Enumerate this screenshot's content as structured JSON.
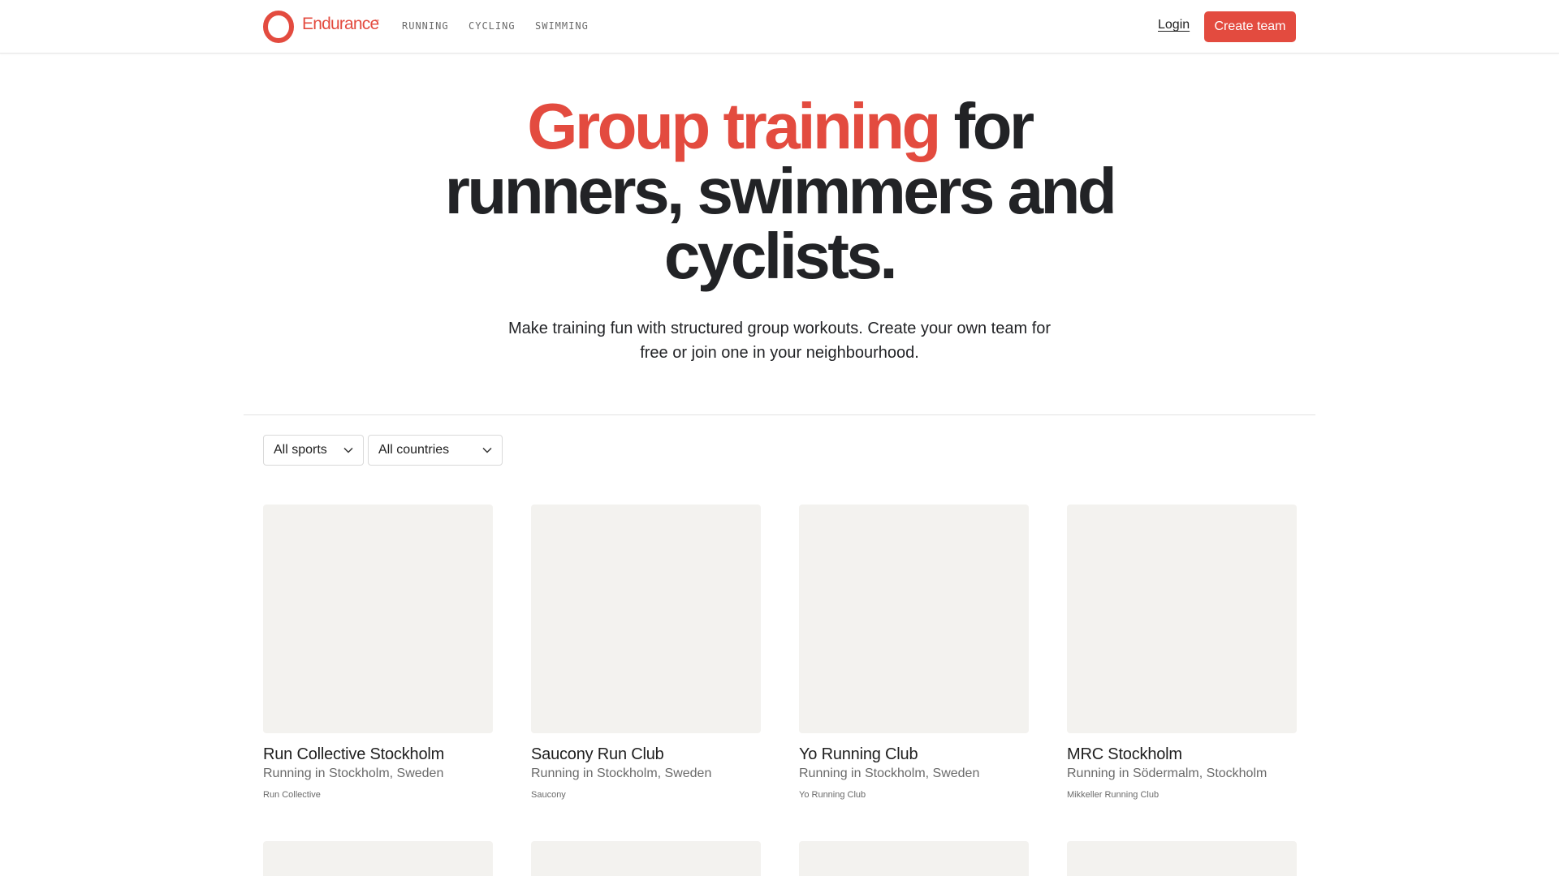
{
  "brand": {
    "name": "Endurance",
    "tm": "™",
    "accent_color": "#e34b3f"
  },
  "nav": {
    "items": [
      {
        "label": "RUNNING"
      },
      {
        "label": "CYCLING"
      },
      {
        "label": "SWIMMING"
      }
    ],
    "login_label": "Login",
    "create_team_label": "Create team"
  },
  "hero": {
    "title_accent": "Group training",
    "title_rest_line1": " for",
    "title_line2": "runners, swimmers and",
    "title_line3": "cyclists.",
    "subtitle": "Make training fun with structured group workouts. Create your own team for free or join one in your neighbourhood."
  },
  "filters": {
    "sports": {
      "selected": "All sports"
    },
    "countries": {
      "selected": "All countries"
    }
  },
  "teams": [
    {
      "name": "Run Collective Stockholm",
      "location": "Running in Stockholm, Sweden",
      "brand": "Run Collective"
    },
    {
      "name": "Saucony Run Club",
      "location": "Running in Stockholm, Sweden",
      "brand": "Saucony"
    },
    {
      "name": "Yo Running Club",
      "location": "Running in Stockholm, Sweden",
      "brand": "Yo Running Club"
    },
    {
      "name": "MRC Stockholm",
      "location": "Running in Södermalm, Stockholm",
      "brand": "Mikkeller Running Club"
    }
  ],
  "colors": {
    "text": "#222326",
    "muted": "#6a6a6a",
    "card_placeholder": "#f3f2ef"
  }
}
